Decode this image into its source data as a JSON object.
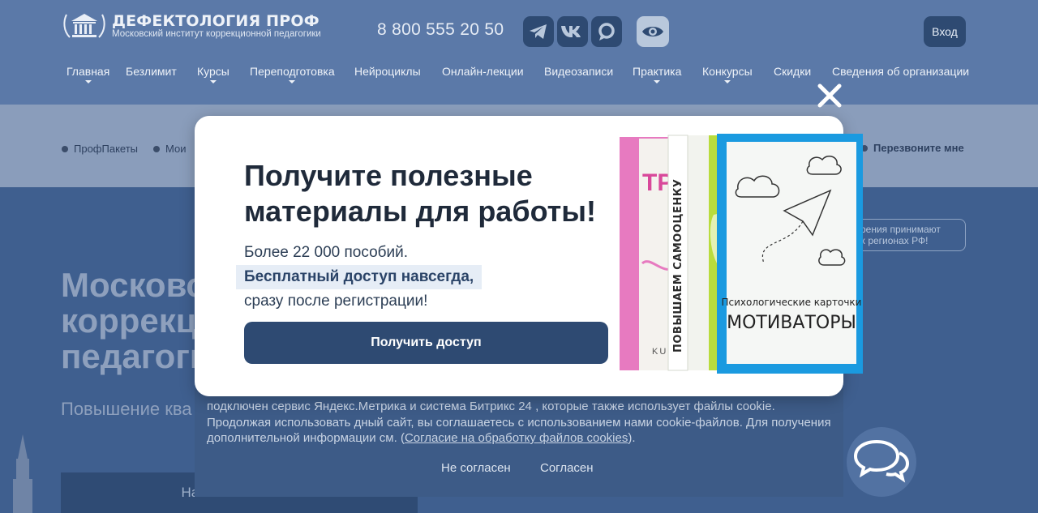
{
  "header": {
    "logo_title": "ДЕФЕКТОЛОГИЯ ПРОФ",
    "logo_subtitle": "Московский институт коррекционной педагогики",
    "phone": "8 800 555 20 50",
    "login_label": "Вход",
    "social_icons": [
      "telegram-icon",
      "vk-icon",
      "max-icon"
    ],
    "accessibility_icon": "eye-icon"
  },
  "nav": {
    "items": [
      {
        "label": "Главная",
        "dropdown": true
      },
      {
        "label": "Безлимит",
        "dropdown": false
      },
      {
        "label": "Курсы",
        "dropdown": true
      },
      {
        "label": "Переподготовка",
        "dropdown": true
      },
      {
        "label": "Нейроциклы",
        "dropdown": false
      },
      {
        "label": "Онлайн-лекции",
        "dropdown": false
      },
      {
        "label": "Видеозаписи",
        "dropdown": false
      },
      {
        "label": "Практика",
        "dropdown": true
      },
      {
        "label": "Конкурсы",
        "dropdown": true
      },
      {
        "label": "Скидки",
        "dropdown": false
      },
      {
        "label": "Сведения об организации",
        "dropdown": false
      }
    ]
  },
  "breadcrumbs": {
    "items": [
      "ПрофПакеты",
      "Мои"
    ],
    "callback": "Перезвоните мне"
  },
  "notice": {
    "line1": "рения принимают",
    "line2": "х регионах РФ!"
  },
  "hero": {
    "title_line1": "Московс",
    "title_line2": "коррекц",
    "title_line3": "педагоги",
    "subtitle": "Повышение ква",
    "start_button": "Начать бесплатно"
  },
  "cookie": {
    "text_before_link": "подключен сервис Яндекс.Метрика и система Битрикс 24 , которые также использует файлы cookie. Продолжая использовать дный сайт, вы соглашаетесь с использованием нами cookie-файлов. Для получения дополнительной информации см. (",
    "link": "Согласие на обработку файлов cookies",
    "text_after_link": ").",
    "decline": "Не согласен",
    "accept": "Согласен"
  },
  "modal": {
    "title": "Получите полезные материалы для работы!",
    "line1": "Более 22 000 пособий.",
    "highlight": "Бесплатный доступ навсегда,",
    "line3": "сразу после регистрации!",
    "cta": "Получить доступ",
    "book_front_line1": "Психологические карточки",
    "book_front_line2": "МОТИВАТОРЫ",
    "book_middle_title": "ПОВЫШАЕМ САМООЦЕНКУ",
    "book_back_title": "ТР М",
    "book_back_bottom": "KUM",
    "close_icon": "close-icon"
  },
  "colors": {
    "header_bg": "#5b79a8",
    "button_dark": "#2e4a72",
    "book_blue": "#1a9ae0",
    "book_pink": "#e77ac0",
    "book_green": "#b9dc3c"
  }
}
